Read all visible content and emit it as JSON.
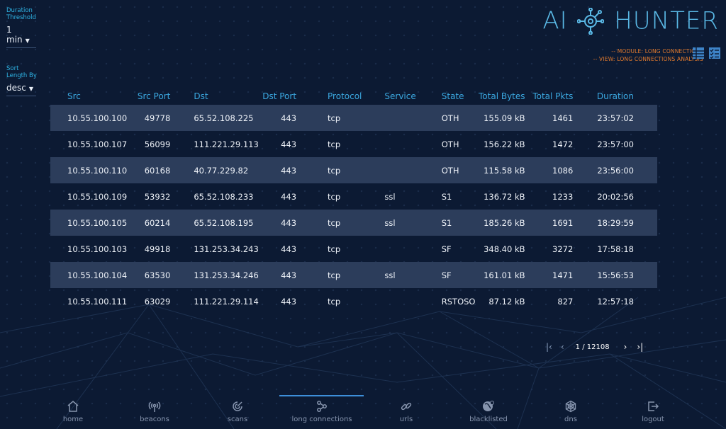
{
  "logo": {
    "left": "AI",
    "right": "HUNTER"
  },
  "filters": {
    "duration": {
      "label_line1": "Duration",
      "label_line2": "Threshold",
      "value": "1 min"
    },
    "sort": {
      "label_line1": "Sort",
      "label_line2": "Length By",
      "value": "desc"
    }
  },
  "module": {
    "module_line": "-- MODULE: LONG CONNECTIONS",
    "view_line": "-- VIEW: LONG CONNECTIONS ANALYSIS"
  },
  "view_icons": [
    {
      "name": "table-view-icon"
    },
    {
      "name": "checklist-view-icon"
    }
  ],
  "table": {
    "headers": [
      "Src",
      "Src Port",
      "Dst",
      "Dst Port",
      "Protocol",
      "Service",
      "State",
      "Total Bytes",
      "Total Pkts",
      "Duration"
    ],
    "rows": [
      [
        "10.55.100.100",
        "49778",
        "65.52.108.225",
        "443",
        "tcp",
        "",
        "OTH",
        "155.09 kB",
        "1461",
        "23:57:02"
      ],
      [
        "10.55.100.107",
        "56099",
        "111.221.29.113",
        "443",
        "tcp",
        "",
        "OTH",
        "156.22 kB",
        "1472",
        "23:57:00"
      ],
      [
        "10.55.100.110",
        "60168",
        "40.77.229.82",
        "443",
        "tcp",
        "",
        "OTH",
        "115.58 kB",
        "1086",
        "23:56:00"
      ],
      [
        "10.55.100.109",
        "53932",
        "65.52.108.233",
        "443",
        "tcp",
        "ssl",
        "S1",
        "136.72 kB",
        "1233",
        "20:02:56"
      ],
      [
        "10.55.100.105",
        "60214",
        "65.52.108.195",
        "443",
        "tcp",
        "ssl",
        "S1",
        "185.26 kB",
        "1691",
        "18:29:59"
      ],
      [
        "10.55.100.103",
        "49918",
        "131.253.34.243",
        "443",
        "tcp",
        "",
        "SF",
        "348.40 kB",
        "3272",
        "17:58:18"
      ],
      [
        "10.55.100.104",
        "63530",
        "131.253.34.246",
        "443",
        "tcp",
        "ssl",
        "SF",
        "161.01 kB",
        "1471",
        "15:56:53"
      ],
      [
        "10.55.100.111",
        "63029",
        "111.221.29.114",
        "443",
        "tcp",
        "",
        "RSTOSO",
        "87.12 kB",
        "827",
        "12:57:18"
      ]
    ]
  },
  "pagination": {
    "text": "1 / 12108",
    "first": "|‹",
    "prev": "‹",
    "next": "›",
    "last": "›|"
  },
  "nav": [
    {
      "label": "home",
      "icon": "home-icon"
    },
    {
      "label": "beacons",
      "icon": "beacon-icon"
    },
    {
      "label": "scans",
      "icon": "scan-icon"
    },
    {
      "label": "long connections",
      "icon": "long-connections-icon",
      "active": true
    },
    {
      "label": "urls",
      "icon": "link-icon"
    },
    {
      "label": "blacklisted",
      "icon": "blacklist-globe-icon"
    },
    {
      "label": "dns",
      "icon": "dns-network-icon"
    },
    {
      "label": "logout",
      "icon": "logout-icon"
    }
  ],
  "colors": {
    "background": "#0c1a33",
    "header_text": "#3ba8e0",
    "module_text": "#e27a2d",
    "row_stripe": "#2c3d5b",
    "active_nav": "#3d8ed8"
  }
}
